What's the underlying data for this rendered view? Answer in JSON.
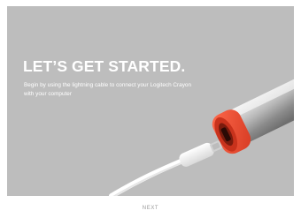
{
  "hero": {
    "headline": "LET’S GET STARTED.",
    "subtitle": "Begin by using the lightning cable to connect your Logitech Crayon with your computer",
    "illustration": "crayon-lightning-cable-illustration"
  },
  "footer": {
    "next_label": "NEXT"
  },
  "colors": {
    "hero_background": "#bdbdbd",
    "accent": "#e8422d",
    "button_text": "#9a9a9a"
  }
}
